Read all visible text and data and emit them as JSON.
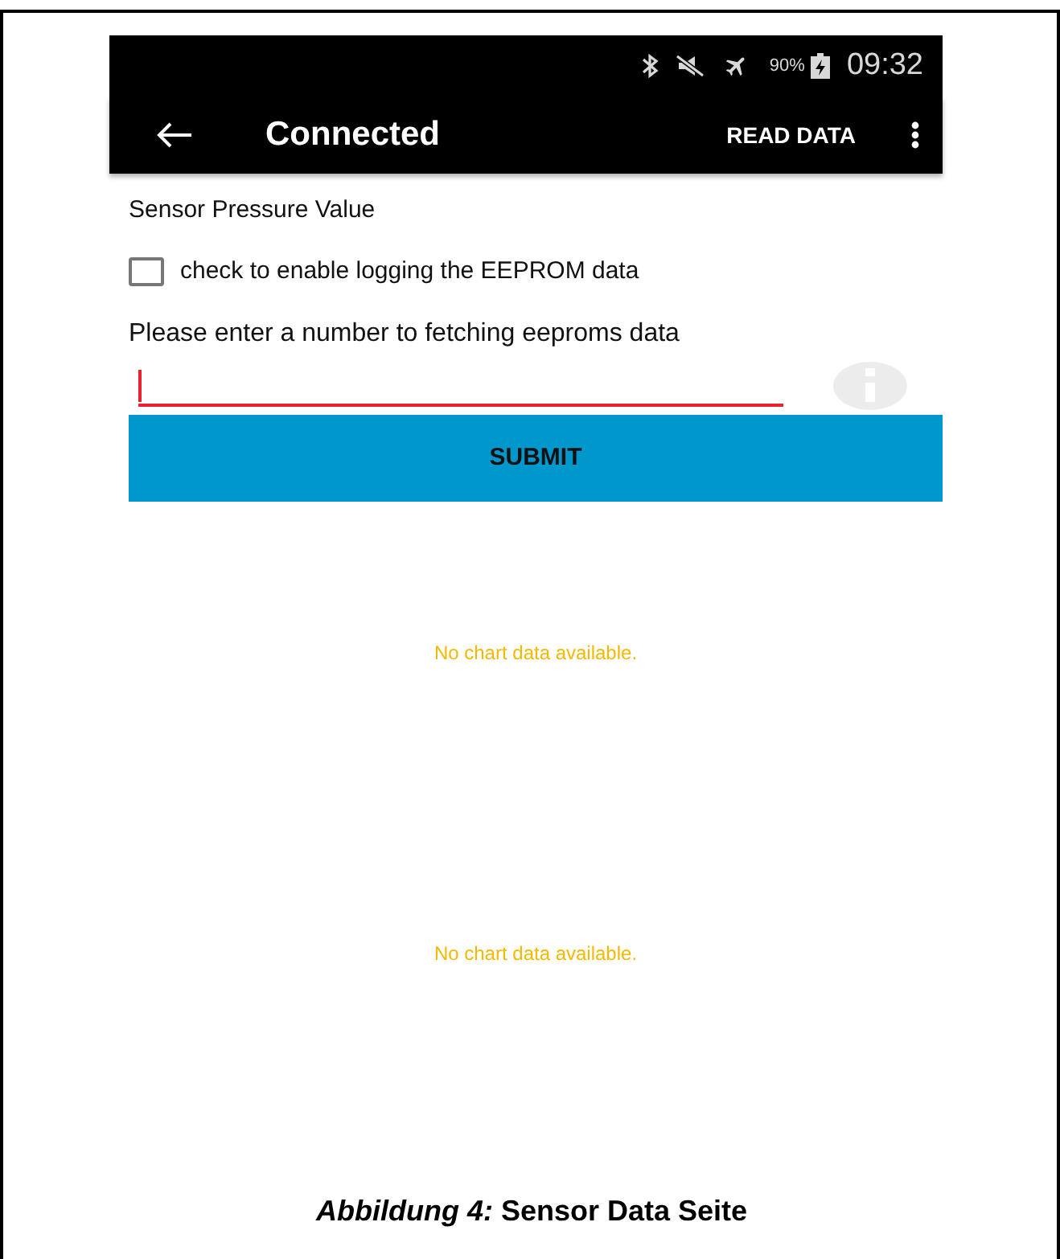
{
  "status_bar": {
    "battery": "90%",
    "time": "09:32"
  },
  "toolbar": {
    "title": "Connected",
    "action": "READ DATA"
  },
  "content": {
    "heading": "Sensor Pressure Value",
    "checkbox": {
      "label": "check to enable logging the EEPROM data",
      "checked": false
    },
    "field_label": "Please enter a number to fetching eeproms data",
    "submit": "SUBMIT",
    "charts": [
      {
        "message": "No chart data available."
      },
      {
        "message": "No chart data available."
      }
    ]
  },
  "caption": "*Abbildung 4:* Sensor Data Seite"
}
